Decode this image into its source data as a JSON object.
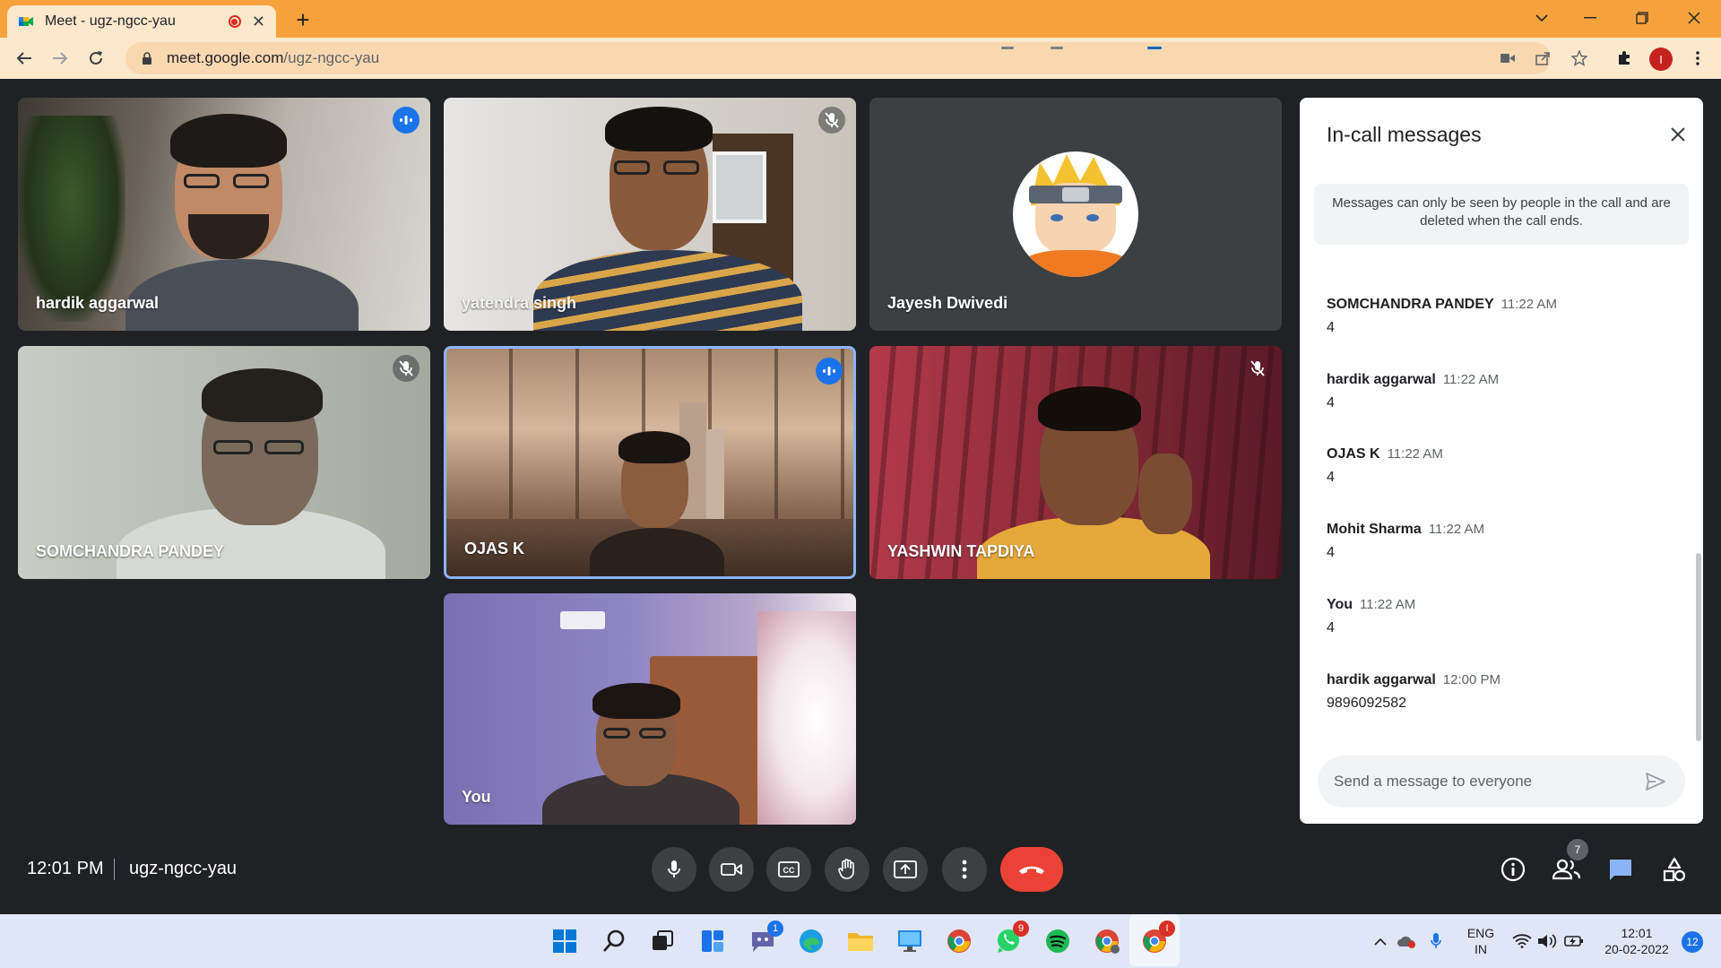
{
  "browser": {
    "tab_title": "Meet - ugz-ngcc-yau",
    "url_host": "meet.google.com",
    "url_path": "/ugz-ngcc-yau",
    "profile_initial": "I"
  },
  "participants": [
    {
      "name": "hardik aggarwal",
      "status": "speaking"
    },
    {
      "name": "yatendra singh",
      "status": "muted"
    },
    {
      "name": "Jayesh Dwivedi",
      "status": "avatar"
    },
    {
      "name": "SOMCHANDRA PANDEY",
      "status": "muted"
    },
    {
      "name": "OJAS K",
      "status": "speaking"
    },
    {
      "name": "YASHWIN TAPDIYA",
      "status": "muted"
    },
    {
      "name": "You",
      "status": "self"
    }
  ],
  "chat": {
    "title": "In-call messages",
    "notice": "Messages can only be seen by people in the call and are deleted when the call ends.",
    "messages": [
      {
        "sender": "SOMCHANDRA PANDEY",
        "time": "11:22 AM",
        "text": "4"
      },
      {
        "sender": "hardik aggarwal",
        "time": "11:22 AM",
        "text": "4"
      },
      {
        "sender": "OJAS K",
        "time": "11:22 AM",
        "text": "4"
      },
      {
        "sender": "Mohit Sharma",
        "time": "11:22 AM",
        "text": "4"
      },
      {
        "sender": "You",
        "time": "11:22 AM",
        "text": "4"
      },
      {
        "sender": "hardik aggarwal",
        "time": "12:00 PM",
        "text": "9896092582"
      }
    ],
    "input_placeholder": "Send a message to everyone"
  },
  "meeting": {
    "time": "12:01 PM",
    "code": "ugz-ngcc-yau",
    "people_count": "7"
  },
  "taskbar": {
    "chat_badge": "1",
    "whatsapp_badge": "9",
    "chrome_profile_badge": "I",
    "lang_line1": "ENG",
    "lang_line2": "IN",
    "clock_time": "12:01",
    "clock_date": "20-02-2022",
    "notification_count": "12"
  },
  "colors": {
    "tab_bar": "#f6a23c",
    "meet_background": "#202124",
    "speaking_blue": "#1a73e8",
    "end_call_red": "#ea4335"
  }
}
